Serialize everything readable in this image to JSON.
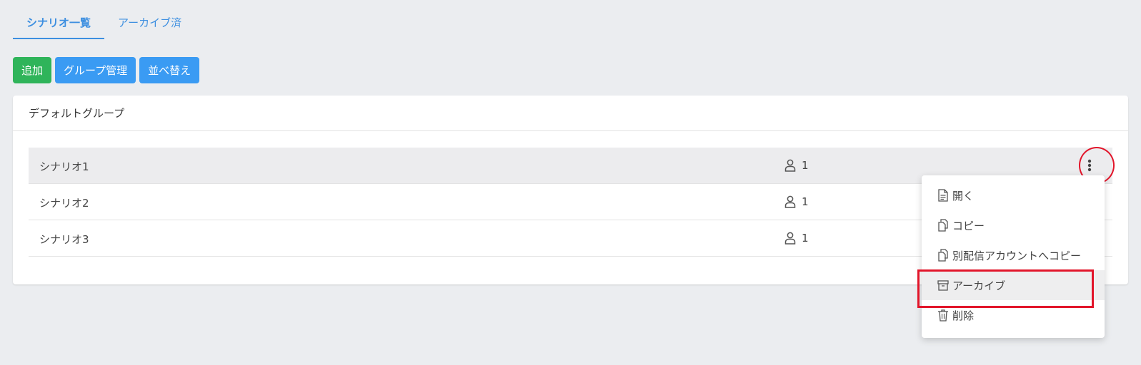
{
  "tabs": [
    {
      "label": "シナリオ一覧",
      "active": true
    },
    {
      "label": "アーカイブ済",
      "active": false
    }
  ],
  "toolbar": {
    "add_label": "追加",
    "group_manage_label": "グループ管理",
    "sort_label": "並べ替え"
  },
  "group": {
    "title": "デフォルトグループ",
    "rows": [
      {
        "name": "シナリオ1",
        "count": "1"
      },
      {
        "name": "シナリオ2",
        "count": "1"
      },
      {
        "name": "シナリオ3",
        "count": "1"
      }
    ]
  },
  "context_menu": {
    "items": [
      {
        "label": "開く",
        "icon": "document-icon"
      },
      {
        "label": "コピー",
        "icon": "copy-icon"
      },
      {
        "label": "別配信アカウントへコピー",
        "icon": "copy-icon"
      },
      {
        "label": "アーカイブ",
        "icon": "archive-icon"
      },
      {
        "label": "削除",
        "icon": "trash-icon"
      }
    ]
  },
  "colors": {
    "accent_blue": "#3a9bf3",
    "add_green": "#2fb45a",
    "annotation_red": "#e2152a"
  }
}
